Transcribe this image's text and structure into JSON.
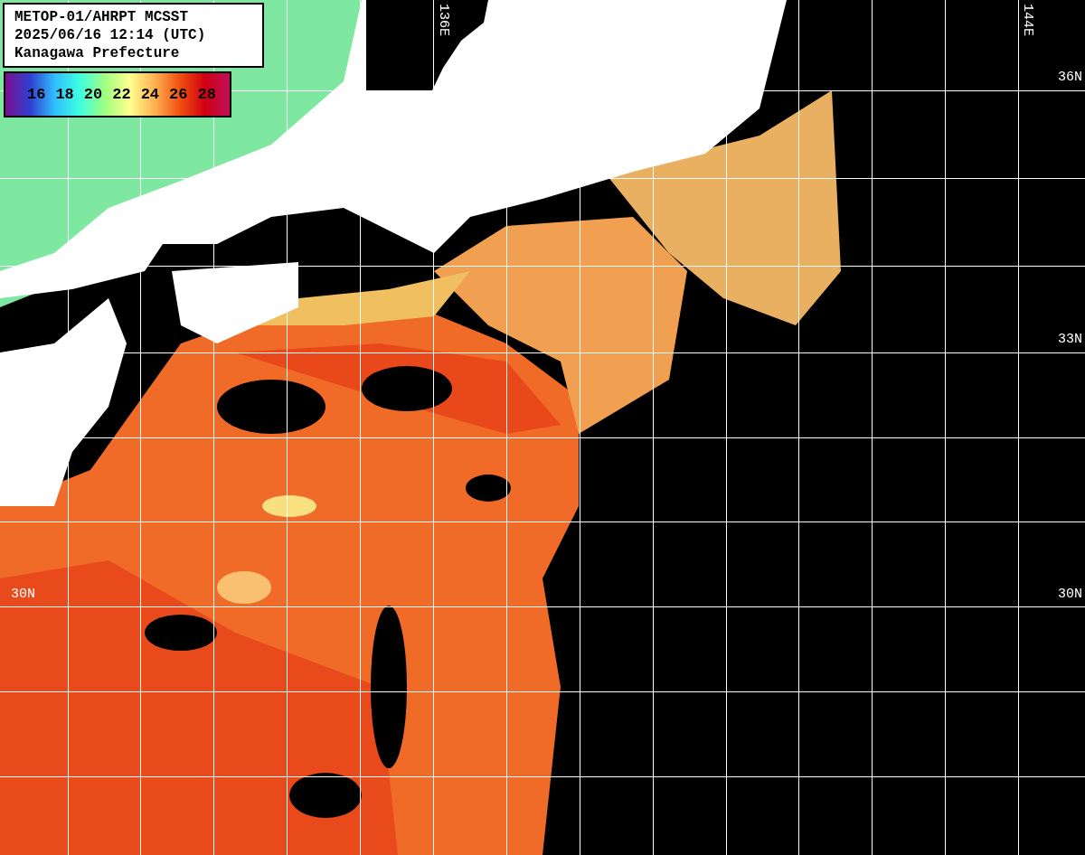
{
  "title_box": {
    "lines": [
      "METOP-01/AHRPT MCSST",
      "2025/06/16 12:14 (UTC)",
      "Kanagawa Prefecture"
    ]
  },
  "legend": {
    "ticks": [
      "16",
      "18",
      "20",
      "22",
      "24",
      "26",
      "28"
    ]
  },
  "map": {
    "labels_top": [
      "136E",
      "144E"
    ],
    "labels_right": [
      "36N",
      "33N",
      "30N"
    ],
    "labels_left": [
      "30N"
    ]
  }
}
